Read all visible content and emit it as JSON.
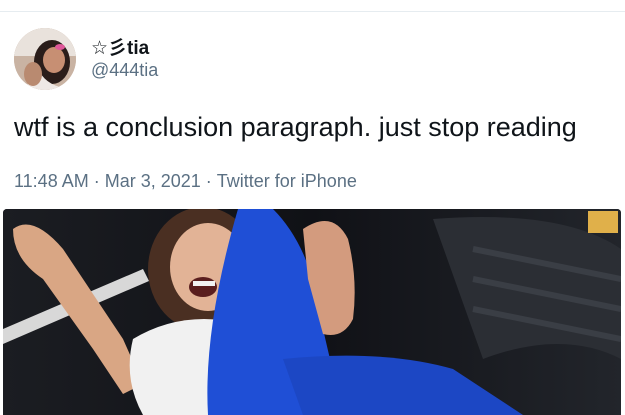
{
  "tweet": {
    "author": {
      "display_name": "☆彡tia",
      "handle": "@444tia"
    },
    "text": "wtf is a conclusion paragraph. just stop reading",
    "time": "11:48 AM",
    "date": "Mar 3, 2021",
    "source": "Twitter for iPhone",
    "separator": "·"
  },
  "colors": {
    "text_primary": "#0f1419",
    "text_secondary": "#5b7083",
    "divider": "#e6ecf0",
    "shirt_blue": "#1f4fd6"
  },
  "icons": {
    "avatar": "profile-photo",
    "media": "gif-laughing-person"
  }
}
